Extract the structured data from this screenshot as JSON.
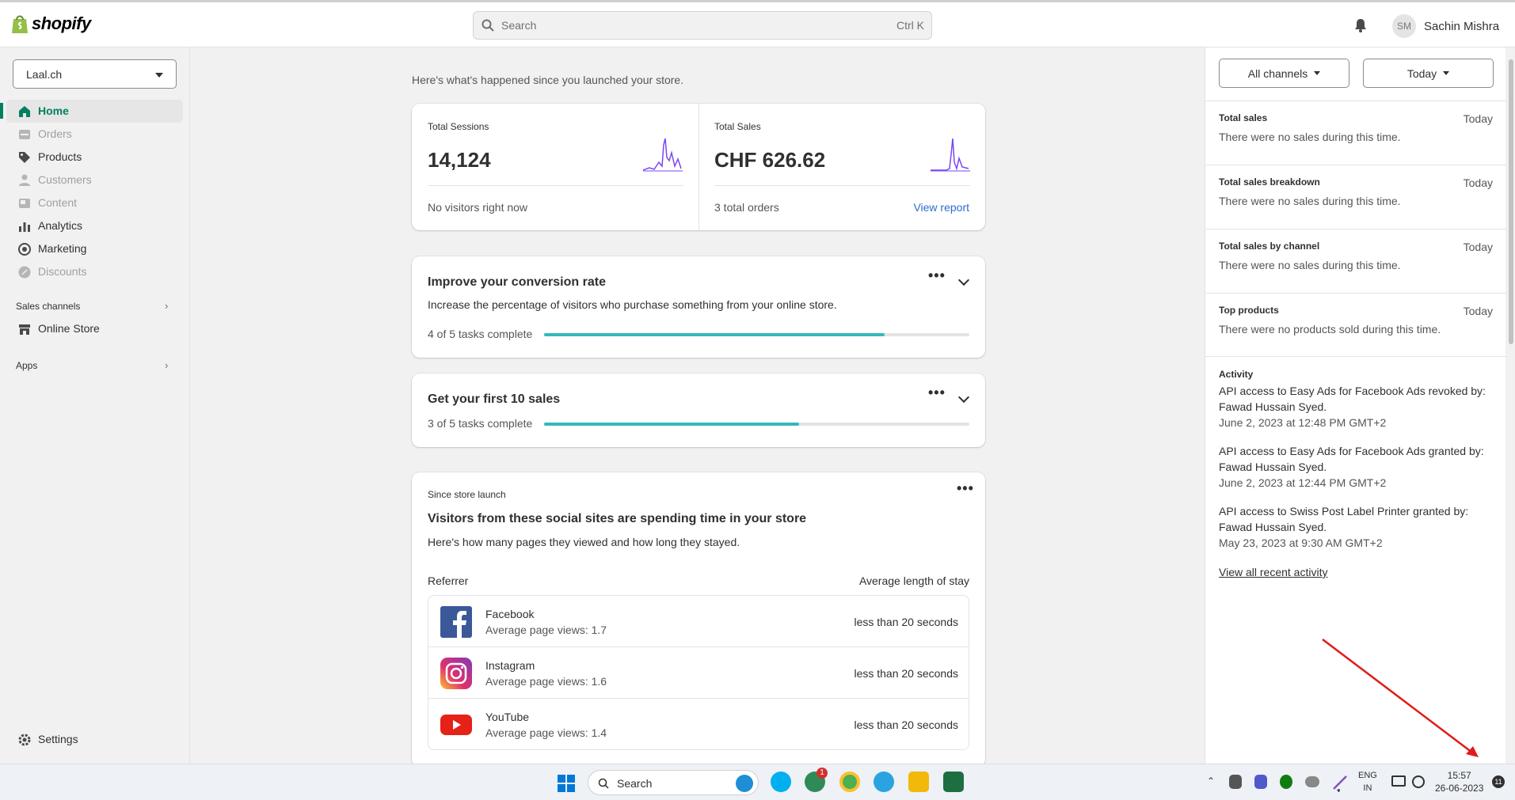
{
  "topbar": {
    "brand": "shopify",
    "search_placeholder": "Search",
    "search_shortcut": "Ctrl K",
    "avatar_initials": "SM",
    "user_name": "Sachin Mishra"
  },
  "sidebar": {
    "store": "Laal.ch",
    "items": [
      {
        "label": "Home",
        "icon": "home-icon",
        "state": "active"
      },
      {
        "label": "Orders",
        "icon": "orders-icon",
        "state": "disabled"
      },
      {
        "label": "Products",
        "icon": "tag-icon",
        "state": "normal"
      },
      {
        "label": "Customers",
        "icon": "person-icon",
        "state": "disabled"
      },
      {
        "label": "Content",
        "icon": "content-icon",
        "state": "disabled"
      },
      {
        "label": "Analytics",
        "icon": "bar-chart-icon",
        "state": "normal"
      },
      {
        "label": "Marketing",
        "icon": "target-icon",
        "state": "normal"
      },
      {
        "label": "Discounts",
        "icon": "discount-icon",
        "state": "disabled"
      }
    ],
    "sales_channels_label": "Sales channels",
    "online_store_label": "Online Store",
    "apps_label": "Apps",
    "settings_label": "Settings"
  },
  "main": {
    "intro": "Here's what's happened since you launched your store.",
    "sessions": {
      "label": "Total Sessions",
      "value": "14,124",
      "footer": "No visitors right now"
    },
    "sales": {
      "label": "Total Sales",
      "value": "CHF 626.62",
      "footer": "3 total orders",
      "link": "View report"
    },
    "conversion": {
      "title": "Improve your conversion rate",
      "desc": "Increase the percentage of visitors who purchase something from your online store.",
      "progress_text": "4 of 5 tasks complete",
      "progress": 0.8
    },
    "first_sales": {
      "title": "Get your first 10 sales",
      "progress_text": "3 of 5 tasks complete",
      "progress": 0.6
    },
    "social": {
      "eyebrow": "Since store launch",
      "title": "Visitors from these social sites are spending time in your store",
      "desc": "Here's how many pages they viewed and how long they stayed.",
      "col_referrer": "Referrer",
      "col_stay": "Average length of stay",
      "rows": [
        {
          "name": "Facebook",
          "views": "Average page views: 1.7",
          "stay": "less than 20 seconds"
        },
        {
          "name": "Instagram",
          "views": "Average page views: 1.6",
          "stay": "less than 20 seconds"
        },
        {
          "name": "YouTube",
          "views": "Average page views: 1.4",
          "stay": "less than 20 seconds"
        }
      ]
    }
  },
  "right_panel": {
    "channels_button": "All channels",
    "date_button": "Today",
    "sections": [
      {
        "title": "Total sales",
        "date": "Today",
        "body": "There were no sales during this time."
      },
      {
        "title": "Total sales breakdown",
        "date": "Today",
        "body": "There were no sales during this time."
      },
      {
        "title": "Total sales by channel",
        "date": "Today",
        "body": "There were no sales during this time."
      },
      {
        "title": "Top products",
        "date": "Today",
        "body": "There were no products sold during this time."
      }
    ],
    "activity_title": "Activity",
    "activity": [
      {
        "text": "API access to Easy Ads for Facebook Ads revoked by: Fawad Hussain Syed.",
        "time": "June 2, 2023 at 12:48 PM GMT+2"
      },
      {
        "text": "API access to Easy Ads for Facebook Ads granted by: Fawad Hussain Syed.",
        "time": "June 2, 2023 at 12:44 PM GMT+2"
      },
      {
        "text": "API access to Swiss Post Label Printer granted by: Fawad Hussain Syed.",
        "time": "May 23, 2023 at 9:30 AM GMT+2"
      }
    ],
    "view_all": "View all recent activity"
  },
  "taskbar": {
    "search_placeholder": "Search",
    "chrome_badge": "1",
    "lang_line1": "ENG",
    "lang_line2": "IN",
    "time": "15:57",
    "date": "26-06-2023",
    "notif_count": "11"
  },
  "colors": {
    "accent": "#008060",
    "progress": "#35b8be",
    "sparkline": "#7b47f1",
    "link": "#2c6ecb"
  }
}
